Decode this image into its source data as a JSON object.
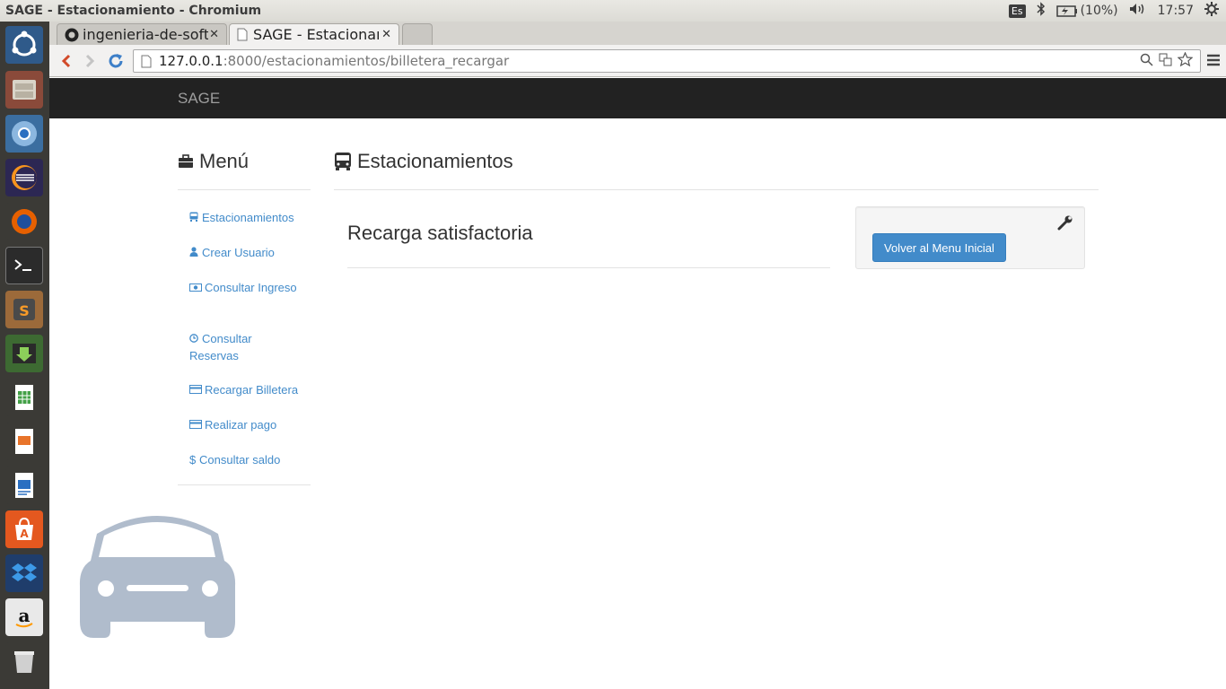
{
  "system_panel": {
    "window_title": "SAGE - Estacionamiento - Chromium",
    "keyboard_layout": "Es",
    "battery": "(10%)",
    "clock": "17:57"
  },
  "launcher": {
    "items": [
      "ubuntu-dash",
      "files",
      "chromium",
      "eclipse",
      "firefox",
      "terminal",
      "sublime-text",
      "update-manager",
      "libreoffice-calc",
      "libreoffice-impress",
      "libreoffice-writer",
      "software-center",
      "dropbox",
      "amazon",
      "trash"
    ]
  },
  "browser": {
    "tabs": [
      {
        "label": "ingenieria-de-software",
        "icon": "github-icon"
      },
      {
        "label": "SAGE - Estacionamiento",
        "icon": "page-icon"
      }
    ],
    "url_host": "127.0.0.1",
    "url_path": ":8000/estacionamientos/billetera_recargar"
  },
  "navbar": {
    "brand": "SAGE"
  },
  "sidebar": {
    "title": "Menú",
    "items": [
      {
        "label": "Estacionamientos",
        "icon": "bus-icon"
      },
      {
        "label": "Crear Usuario",
        "icon": "user-icon"
      },
      {
        "label": "Consultar Ingreso",
        "icon": "money-icon"
      },
      {
        "label": "Consultar\nReservas",
        "icon": "clock-icon"
      },
      {
        "label": "Recargar Billetera",
        "icon": "credit-card-icon"
      },
      {
        "label": "Realizar pago",
        "icon": "credit-card-icon"
      },
      {
        "label": "Consultar saldo",
        "icon": "dollar-icon"
      }
    ]
  },
  "main": {
    "title": "Estacionamientos",
    "message": "Recarga satisfactoria",
    "back_button": "Volver al Menu Inicial"
  },
  "colors": {
    "navbar_bg": "#222222",
    "link": "#428bca",
    "primary_button": "#428bca",
    "car_illustration": "#b0bccc"
  }
}
